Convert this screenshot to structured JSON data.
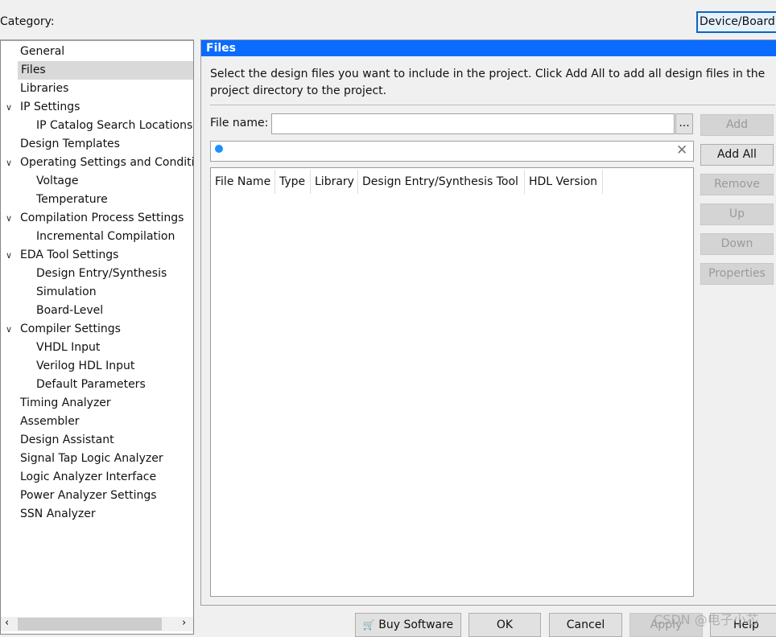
{
  "category_label": "Category:",
  "device_board_button": "Device/Board...",
  "tree": [
    {
      "label": "General",
      "level": 0
    },
    {
      "label": "Files",
      "level": 0,
      "selected": true
    },
    {
      "label": "Libraries",
      "level": 0
    },
    {
      "label": "IP Settings",
      "level": 0,
      "expanded": true
    },
    {
      "label": "IP Catalog Search Locations",
      "level": 1
    },
    {
      "label": "Design Templates",
      "level": 0
    },
    {
      "label": "Operating Settings and Conditions",
      "level": 0,
      "expanded": true
    },
    {
      "label": "Voltage",
      "level": 1
    },
    {
      "label": "Temperature",
      "level": 1
    },
    {
      "label": "Compilation Process Settings",
      "level": 0,
      "expanded": true
    },
    {
      "label": "Incremental Compilation",
      "level": 1
    },
    {
      "label": "EDA Tool Settings",
      "level": 0,
      "expanded": true
    },
    {
      "label": "Design Entry/Synthesis",
      "level": 1
    },
    {
      "label": "Simulation",
      "level": 1
    },
    {
      "label": "Board-Level",
      "level": 1
    },
    {
      "label": "Compiler Settings",
      "level": 0,
      "expanded": true
    },
    {
      "label": "VHDL Input",
      "level": 1
    },
    {
      "label": "Verilog HDL Input",
      "level": 1
    },
    {
      "label": "Default Parameters",
      "level": 1
    },
    {
      "label": "Timing Analyzer",
      "level": 0
    },
    {
      "label": "Assembler",
      "level": 0
    },
    {
      "label": "Design Assistant",
      "level": 0
    },
    {
      "label": "Signal Tap Logic Analyzer",
      "level": 0
    },
    {
      "label": "Logic Analyzer Interface",
      "level": 0
    },
    {
      "label": "Power Analyzer Settings",
      "level": 0
    },
    {
      "label": "SSN Analyzer",
      "level": 0
    }
  ],
  "panel": {
    "title": "Files",
    "description": "Select the design files you want to include in the project. Click Add All to add all design files in the project directory to the project.",
    "file_name_label": "File name:",
    "file_name_value": "",
    "browse_label": "...",
    "search_value": "",
    "columns": [
      "File Name",
      "Type",
      "Library",
      "Design Entry/Synthesis Tool",
      "HDL Version"
    ],
    "buttons": {
      "add": "Add",
      "add_all": "Add All",
      "remove": "Remove",
      "up": "Up",
      "down": "Down",
      "properties": "Properties"
    }
  },
  "footer": {
    "buy": "Buy Software",
    "ok": "OK",
    "cancel": "Cancel",
    "apply": "Apply",
    "help": "Help"
  },
  "watermark": "CSDN @电子小芯"
}
